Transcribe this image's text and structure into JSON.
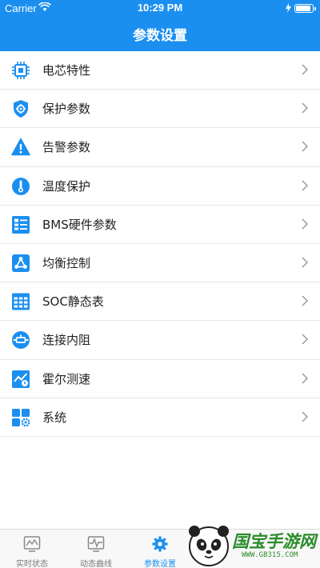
{
  "status_bar": {
    "carrier": "Carrier",
    "time": "10:29 PM",
    "battery_level": 0.9
  },
  "header": {
    "title": "参数设置"
  },
  "menu": [
    {
      "label": "电芯特性",
      "icon": "chip-icon"
    },
    {
      "label": "保护参数",
      "icon": "shield-gear-icon"
    },
    {
      "label": "告警参数",
      "icon": "warning-icon"
    },
    {
      "label": "温度保护",
      "icon": "thermometer-icon"
    },
    {
      "label": "BMS硬件参数",
      "icon": "hardware-list-icon"
    },
    {
      "label": "均衡控制",
      "icon": "balance-nodes-icon"
    },
    {
      "label": "SOC静态表",
      "icon": "table-icon"
    },
    {
      "label": "连接内阻",
      "icon": "resistor-icon"
    },
    {
      "label": "霍尔测速",
      "icon": "speed-chart-icon"
    },
    {
      "label": "系统",
      "icon": "system-grid-icon"
    }
  ],
  "tabbar": {
    "tabs": [
      {
        "label": "实时状态",
        "icon": "realtime-monitor-icon",
        "active": false
      },
      {
        "label": "动态曲线",
        "icon": "curve-monitor-icon",
        "active": false
      },
      {
        "label": "参数设置",
        "icon": "gear-icon",
        "active": true
      }
    ]
  },
  "watermark": {
    "text": "国宝手游网",
    "url": "WWW.GB315.COM"
  },
  "colors": {
    "accent": "#1b8ff0",
    "text": "#222222",
    "tab_inactive": "#777777"
  }
}
